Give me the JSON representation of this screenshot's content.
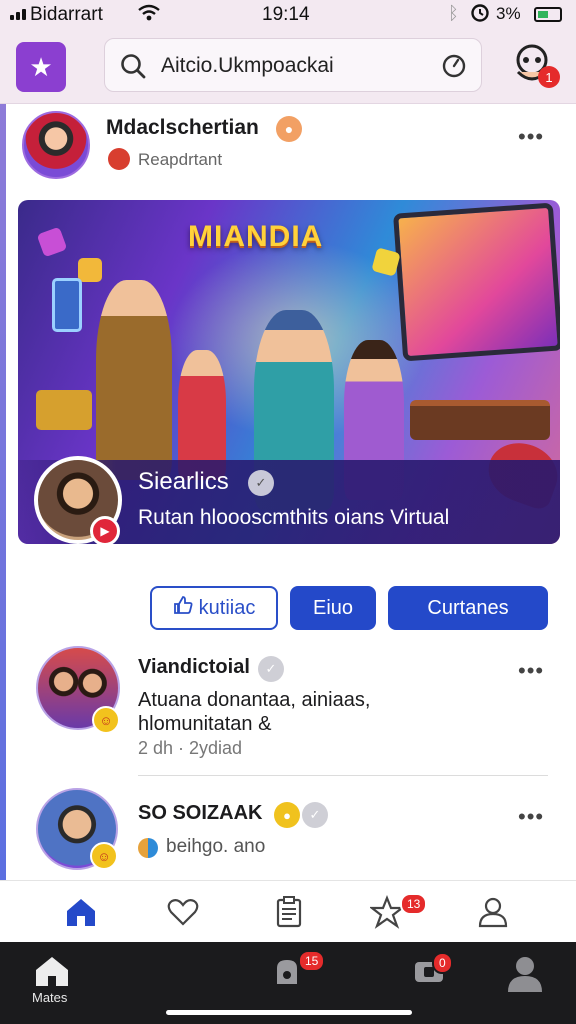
{
  "status_bar": {
    "carrier": "Bidarrart",
    "time": "19:14",
    "battery_pct": "3%"
  },
  "header": {
    "search_placeholder": "Aitcio.Ukmpoackai",
    "notification_count": "1"
  },
  "profile": {
    "name": "Mdaclschertian",
    "subtitle": "Reapdrtant"
  },
  "banner": {
    "title": "MIANDIA",
    "host_name": "Siearlics",
    "description": "Rutan hloooscmthits oians Virtual"
  },
  "actions": {
    "like_label": "kutiiac",
    "middle_label": "Eiuo",
    "right_label": "Curtanes"
  },
  "feed": [
    {
      "title": "Viandictoial",
      "text": "Atuana donantaa, ainiaas, hlomunitatan &",
      "time": "2 dh · 2ydiad"
    },
    {
      "title": "SO SOIZAAK",
      "subtitle": "beihgo. ano"
    }
  ],
  "tabbar": {
    "items": [
      "home",
      "favorites",
      "clipboard",
      "stars",
      "profile"
    ],
    "stars_badge": "13"
  },
  "dock": {
    "home_label": "Mates",
    "alerts_badge": "15",
    "chat_badge": "0"
  },
  "colors": {
    "accent_purple": "#8b3fd0",
    "primary_blue": "#2449c9",
    "badge_red": "#e52b2b",
    "verified_orange": "#f2a064",
    "header_bg": "#f3e9f1"
  }
}
